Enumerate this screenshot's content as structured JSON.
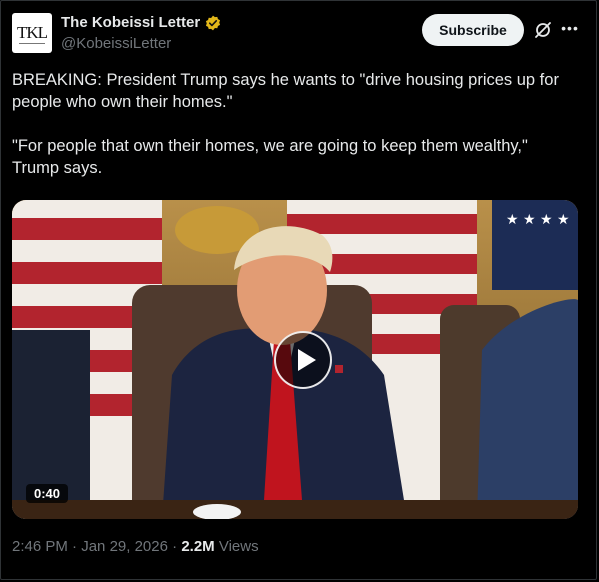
{
  "author": {
    "name": "The Kobeissi Letter",
    "handle": "@KobeissiLetter",
    "avatar_text": "TKL",
    "verified_color": "#e2b719"
  },
  "actions": {
    "subscribe_label": "Subscribe",
    "grok_icon": "grok-icon",
    "more_icon": "more-icon"
  },
  "post": {
    "text": "BREAKING: President Trump says he wants to \"drive housing prices up for people who own their homes.\"\n\n\"For people that own their homes, we are going to keep them wealthy,\" Trump says."
  },
  "video": {
    "duration": "0:40"
  },
  "footer": {
    "time": "2:46 PM",
    "separator": "·",
    "date": "Jan 29, 2026",
    "views_count": "2.2M",
    "views_label": "Views"
  }
}
